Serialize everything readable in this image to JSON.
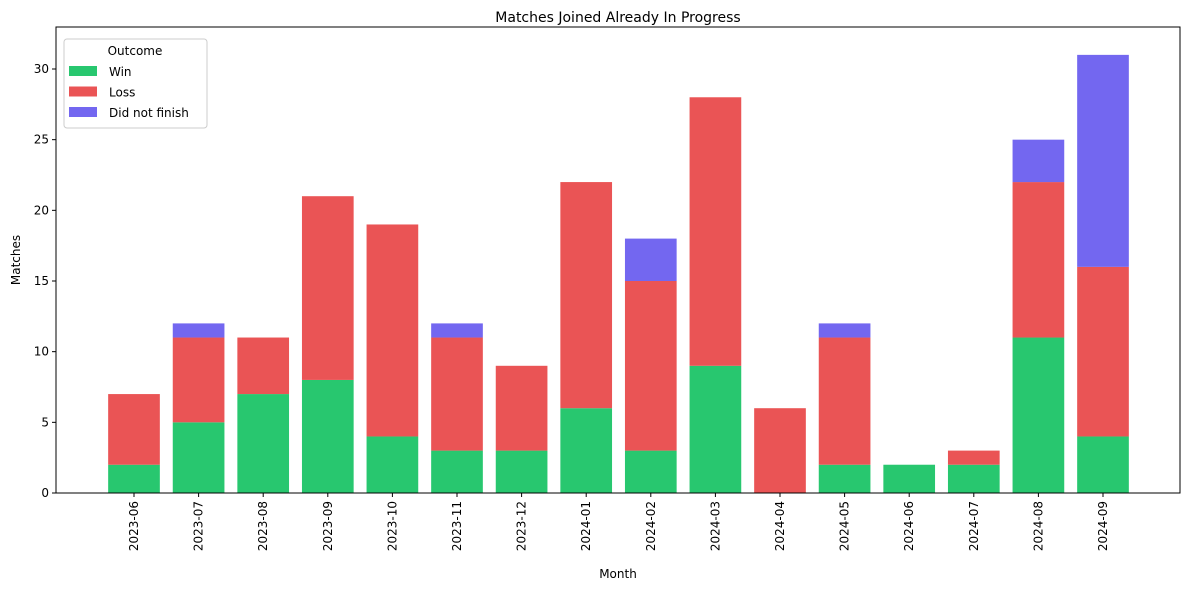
{
  "chart_data": {
    "type": "bar",
    "stacked": true,
    "title": "Matches Joined Already In Progress",
    "xlabel": "Month",
    "ylabel": "Matches",
    "ylim": [
      0,
      32.5
    ],
    "yticks": [
      0,
      5,
      10,
      15,
      20,
      25,
      30
    ],
    "grid": false,
    "legend": {
      "title": "Outcome",
      "placement": "top-left"
    },
    "categories": [
      "2023-06",
      "2023-07",
      "2023-08",
      "2023-09",
      "2023-10",
      "2023-11",
      "2023-12",
      "2024-01",
      "2024-02",
      "2024-03",
      "2024-04",
      "2024-05",
      "2024-06",
      "2024-07",
      "2024-08",
      "2024-09"
    ],
    "series": [
      {
        "name": "Win",
        "color": "#28c76f",
        "values": [
          2,
          5,
          7,
          8,
          4,
          3,
          3,
          6,
          3,
          9,
          0,
          2,
          2,
          2,
          11,
          4
        ]
      },
      {
        "name": "Loss",
        "color": "#ea5455",
        "values": [
          5,
          6,
          4,
          13,
          15,
          8,
          6,
          16,
          12,
          19,
          6,
          9,
          0,
          1,
          11,
          12
        ]
      },
      {
        "name": "Did not finish",
        "color": "#7367f0",
        "values": [
          0,
          1,
          0,
          0,
          0,
          1,
          0,
          0,
          3,
          0,
          0,
          1,
          0,
          0,
          3,
          15
        ]
      }
    ]
  }
}
